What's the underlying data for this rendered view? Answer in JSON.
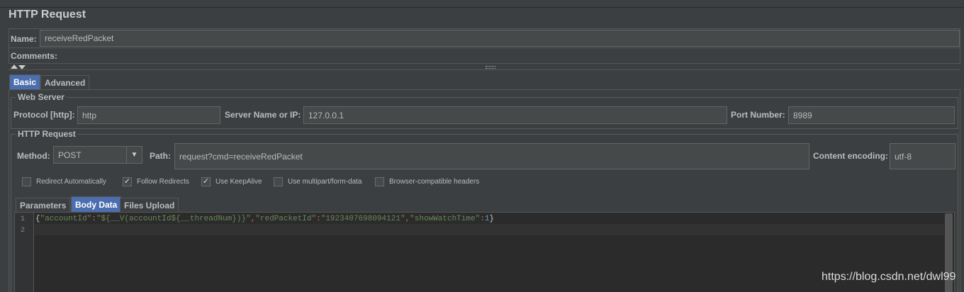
{
  "page": {
    "title": "HTTP Request"
  },
  "name_row": {
    "label": "Name:",
    "value": "receiveRedPacket"
  },
  "comments_row": {
    "label": "Comments:"
  },
  "main_tabs": [
    {
      "label": "Basic",
      "active": true
    },
    {
      "label": "Advanced",
      "active": false
    }
  ],
  "web_server": {
    "legend": "Web Server",
    "protocol": {
      "label": "Protocol [http]:",
      "value": "http"
    },
    "server": {
      "label": "Server Name or IP:",
      "value": "127.0.0.1"
    },
    "port": {
      "label": "Port Number:",
      "value": "8989"
    }
  },
  "http_request": {
    "legend": "HTTP Request",
    "method": {
      "label": "Method:",
      "value": "POST"
    },
    "path": {
      "label": "Path:",
      "value": "request?cmd=receiveRedPacket"
    },
    "encoding": {
      "label": "Content encoding:",
      "value": "utf-8"
    },
    "checkboxes": [
      {
        "label": "Redirect Automatically",
        "checked": false
      },
      {
        "label": "Follow Redirects",
        "checked": true
      },
      {
        "label": "Use KeepAlive",
        "checked": true
      },
      {
        "label": "Use multipart/form-data",
        "checked": false
      },
      {
        "label": "Browser-compatible headers",
        "checked": false
      }
    ]
  },
  "sub_tabs": [
    {
      "label": "Parameters",
      "active": false
    },
    {
      "label": "Body Data",
      "active": true
    },
    {
      "label": "Files Upload",
      "active": false
    }
  ],
  "editor": {
    "line_numbers": [
      "1",
      "2"
    ],
    "line1": {
      "p1": "{",
      "k1": "\"accountId\"",
      "c1": ":",
      "v1": "\"${__V(accountId${__threadNum})}\"",
      "c2": ",",
      "k2": "\"redPacketId\"",
      "c3": ":",
      "v2": "\"1923407698094121\"",
      "c4": ",",
      "k3": "\"showWatchTime\"",
      "c5": ":",
      "v3": "1",
      "p2": "}"
    }
  },
  "watermark": "https://blog.csdn.net/dwl99",
  "colors": {
    "active_tab": "#4b6eaf",
    "background": "#3c3f41",
    "editor_bg": "#2b2b2b",
    "string": "#6a8759"
  }
}
